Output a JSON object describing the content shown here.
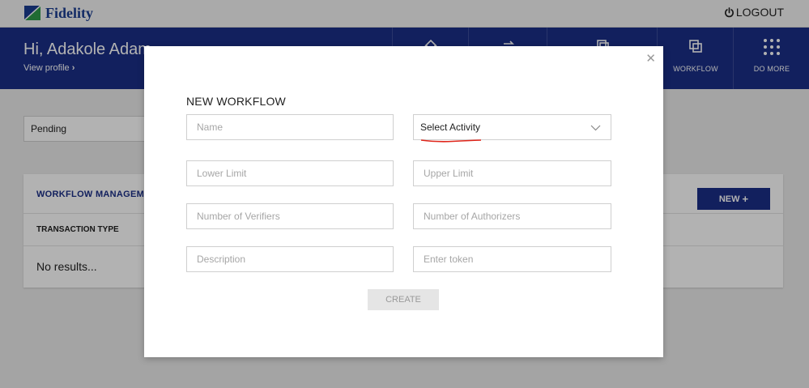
{
  "brand": {
    "name": "Fidelity"
  },
  "topbar": {
    "logout_label": "LOGOUT"
  },
  "header": {
    "greeting": "Hi, Adakole Adam",
    "view_profile_label": "View profile",
    "nav": [
      {
        "label": "",
        "icon": "home-icon"
      },
      {
        "label": "",
        "icon": "transfer-icon"
      },
      {
        "label": "",
        "icon": "document-icon"
      },
      {
        "label": "WORKFLOW",
        "icon": "workflow-icon"
      },
      {
        "label": "DO MORE",
        "icon": "grid-dots-icon"
      }
    ]
  },
  "page": {
    "filter_value": "Pending",
    "card_title": "WORKFLOW MANAGEMI",
    "new_button_label": "NEW",
    "column_header": "TRANSACTION TYPE",
    "empty_text": "No results..."
  },
  "modal": {
    "title": "NEW WORKFLOW",
    "close_icon": "close-icon",
    "fields": {
      "name_placeholder": "Name",
      "activity_value": "Select Activity",
      "lower_limit_placeholder": "Lower Limit",
      "upper_limit_placeholder": "Upper Limit",
      "verifiers_placeholder": "Number of Verifiers",
      "authorizers_placeholder": "Number of Authorizers",
      "description_placeholder": "Description",
      "token_placeholder": "Enter token"
    },
    "create_label": "CREATE"
  },
  "colors": {
    "brand_blue": "#1b2f87",
    "annotation_red": "#e0261b"
  }
}
